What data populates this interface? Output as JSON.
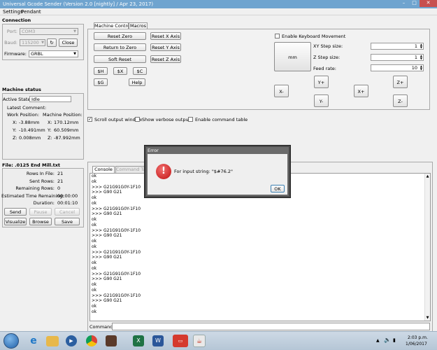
{
  "window": {
    "title": "Universal Gcode Sender (Version 2.0 [nightly] / Apr 23, 2017)"
  },
  "menu": {
    "settings": "Settings",
    "pendant": "Pendant"
  },
  "connection": {
    "title": "Connection",
    "port_label": "Port:",
    "port_value": "COM3",
    "baud_label": "Baud:",
    "baud_value": "115200",
    "close_label": "Close",
    "firmware_label": "Firmware:",
    "firmware_value": "GRBL"
  },
  "machine_status": {
    "title": "Machine status",
    "active_state_label": "Active State:",
    "active_state_value": "Idle",
    "latest_comment_label": "Latest Comment:",
    "work_position_label": "Work Position:",
    "machine_position_label": "Machine Position:",
    "x_label": "X:",
    "y_label": "Y:",
    "z_label": "Z:",
    "work_x": "-3.88mm",
    "work_y": "-10.491mm",
    "work_z": "0.008mm",
    "mach_x": "170.12mm",
    "mach_y": "60.509mm",
    "mach_z": "-87.992mm"
  },
  "file": {
    "title": "File: .0125 End Mill.txt",
    "rows_in_file_label": "Rows In File:",
    "rows_in_file": "21",
    "sent_rows_label": "Sent Rows:",
    "sent_rows": "21",
    "remaining_rows_label": "Remaining Rows:",
    "remaining_rows": "0",
    "est_time_label": "Estimated Time Remaining:",
    "est_time": "00:00:00",
    "duration_label": "Duration:",
    "duration": "00:01:10",
    "send": "Send",
    "pause": "Pause",
    "cancel": "Cancel",
    "visualize": "Visualize",
    "browse": "Browse",
    "save": "Save"
  },
  "tabs": {
    "machine_control": "Machine Control",
    "macros": "Macros"
  },
  "control": {
    "reset_zero": "Reset Zero",
    "reset_x": "Reset X Axis",
    "return_to_zero": "Return to Zero",
    "reset_y": "Reset Y Axis",
    "soft_reset": "Soft Reset",
    "reset_z": "Reset Z Axis",
    "h": "$H",
    "x": "$X",
    "c": "$C",
    "g": "$G",
    "help": "Help"
  },
  "jog": {
    "enable_keyboard": "Enable Keyboard Movement",
    "unit": "mm",
    "xy_step_label": "XY Step size:",
    "xy_step": "1",
    "z_step_label": "Z Step size:",
    "z_step": "1",
    "feed_rate_label": "Feed rate:",
    "feed_rate": "10",
    "x_minus": "X-",
    "x_plus": "X+",
    "y_plus": "Y+",
    "y_minus": "Y-",
    "z_plus": "Z+",
    "z_minus": "Z-"
  },
  "options": {
    "scroll_output": "Scroll output window",
    "scroll_output_checked": true,
    "verbose_output": "Show verbose output",
    "command_table": "Enable command table"
  },
  "console": {
    "tab_console": "Console",
    "tab_command_table": "Command Table",
    "lines": [
      "ok",
      "ok",
      ">>> G21G91G0Y-1F10",
      ">>> G90 G21",
      "ok",
      "ok",
      ">>> G21G91G0Y-1F10",
      ">>> G90 G21",
      "ok",
      "ok",
      ">>> G21G91G0Y-1F10",
      ">>> G90 G21",
      "ok",
      "ok",
      ">>> G21G91G0Y-1F10",
      ">>> G90 G21",
      "ok",
      "ok",
      ">>> G21G91G0Y-1F10",
      ">>> G90 G21",
      "ok",
      "ok",
      ">>> G21G91G0Y-1F10",
      ">>> G90 G21",
      "ok",
      "ok"
    ],
    "command_label": "Command:"
  },
  "dialog": {
    "title": "Error",
    "message": "For input string: \"$#76.2\"",
    "ok": "OK"
  },
  "taskbar": {
    "time": "2:03 p.m.",
    "date": "1/06/2017"
  },
  "colors": {
    "titlebar": "#6fa4cf",
    "error_icon": "#d42020",
    "accent": "#3c7fb1"
  }
}
